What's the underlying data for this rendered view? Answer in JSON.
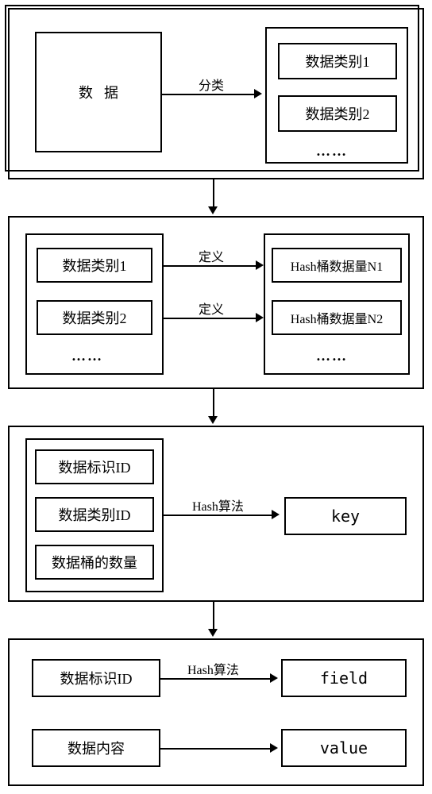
{
  "stage1": {
    "data_box": "数据",
    "arrow_label": "分类",
    "cat1": "数据类别1",
    "cat2": "数据类别2",
    "dots": "……"
  },
  "stage2": {
    "left_cat1": "数据类别1",
    "left_cat2": "数据类别2",
    "left_dots": "……",
    "arrow1_label": "定义",
    "arrow2_label": "定义",
    "right_n1": "Hash桶数据量N1",
    "right_n2": "Hash桶数据量N2",
    "right_dots": "……"
  },
  "stage3": {
    "id_label": "数据标识ID",
    "cat_id_label": "数据类别ID",
    "bucket_count": "数据桶的数量",
    "arrow_label": "Hash算法",
    "key_label": "key"
  },
  "stage4": {
    "id_label": "数据标识ID",
    "arrow1_label": "Hash算法",
    "field_label": "field",
    "content_label": "数据内容",
    "value_label": "value"
  }
}
